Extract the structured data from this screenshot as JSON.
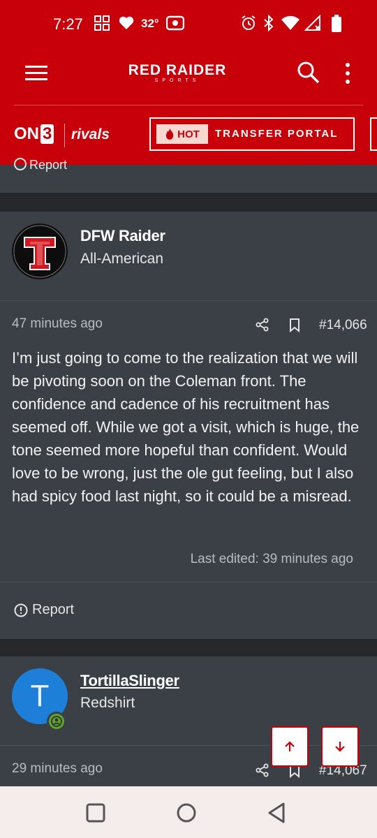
{
  "status_bar": {
    "time": "7:27",
    "temperature": "32°"
  },
  "header": {
    "logo_main": "RED RAIDER",
    "logo_sub": "SPORTS",
    "on3": "ON",
    "on3_num": "3",
    "rivals": "rivals",
    "hot_label": "HOT",
    "transfer_label": "TRANSFER PORTAL"
  },
  "prev_post": {
    "report_label": "Report"
  },
  "post1": {
    "author": "DFW Raider",
    "rank": "All-American",
    "time": "47 minutes ago",
    "number": "#14,066",
    "body": "I’m just going to come to the realization that we will be pivoting soon on the Coleman front. The confidence and cadence of his recruitment has seemed off. While we got a visit, which is huge, the tone seemed more hopeful than confident. Would love to be wrong, just the ole gut feeling, but I also had spicy food last night, so it could be a misread.",
    "edited": "Last edited: 39 minutes ago",
    "report_label": "Report"
  },
  "post2": {
    "avatar_letter": "T",
    "author": "TortillaSlinger",
    "rank": "Redshirt",
    "time": "29 minutes ago",
    "number": "#14,067"
  },
  "colors": {
    "brand_red": "#c8000a",
    "card_bg": "#3b3f46",
    "page_bg": "#26282c",
    "avatar_blue": "#1e7fd8"
  }
}
